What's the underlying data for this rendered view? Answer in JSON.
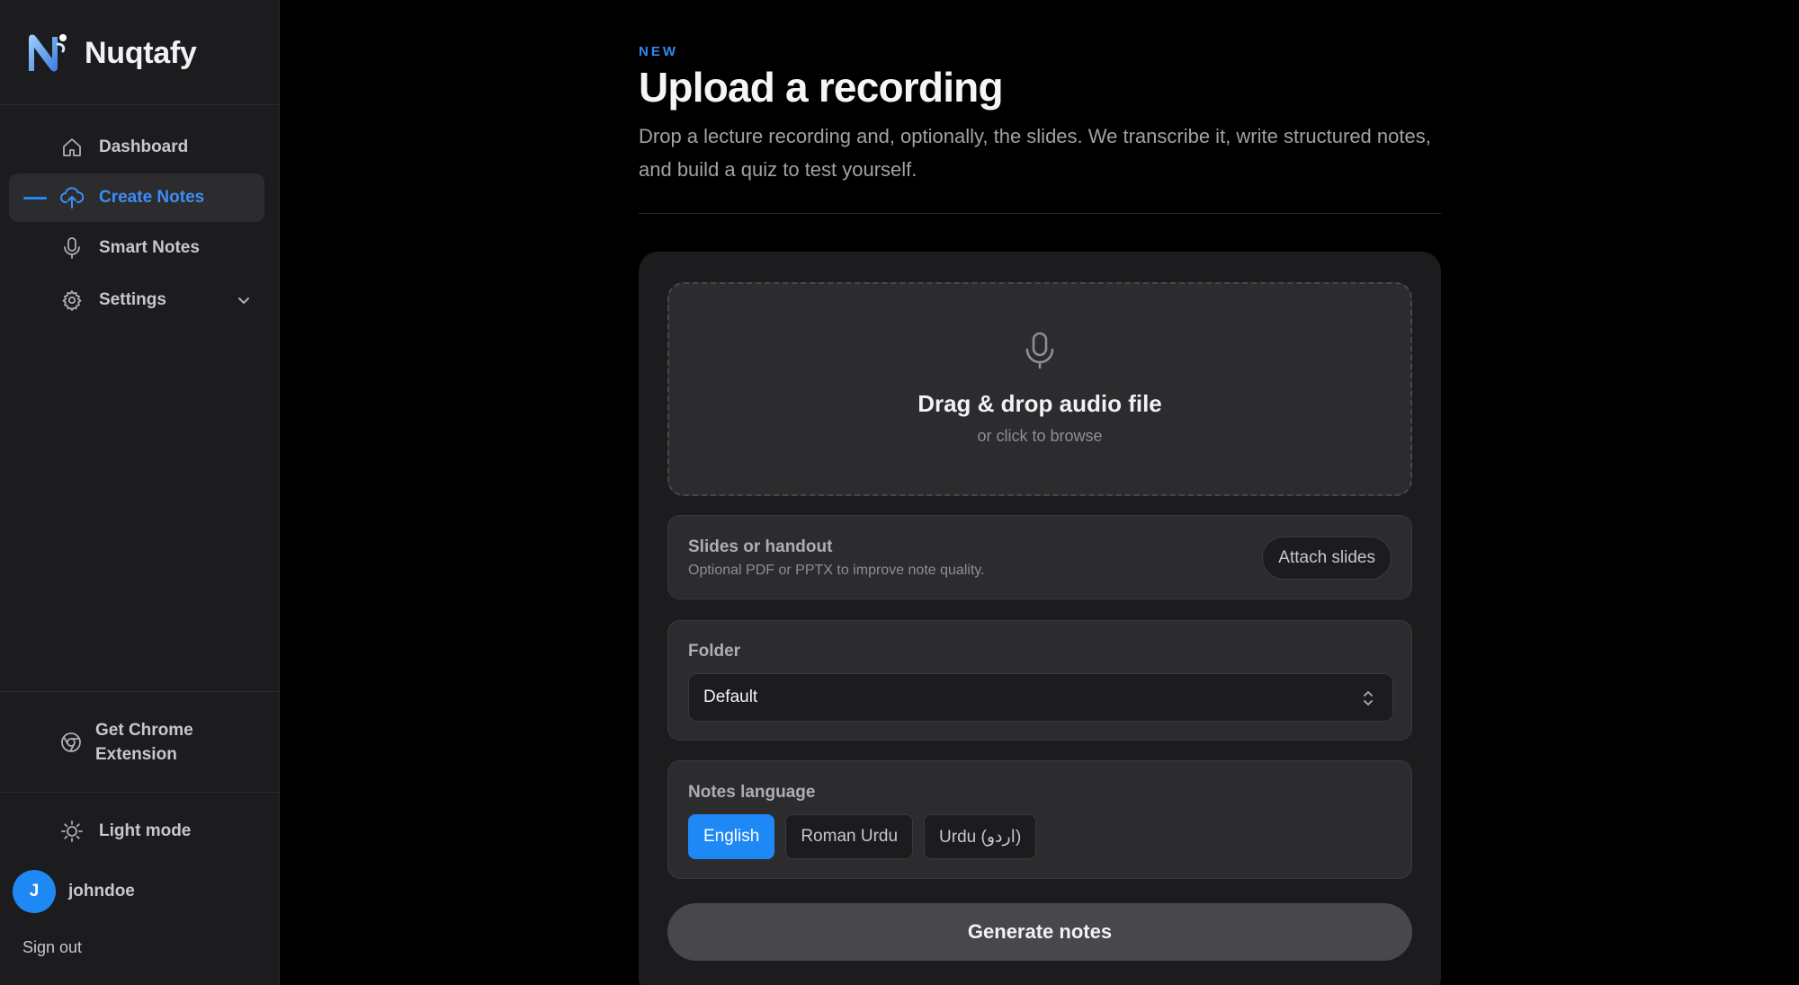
{
  "brand": {
    "name": "Nuqtafy"
  },
  "sidebar": {
    "items": [
      {
        "label": "Dashboard",
        "icon": "home-icon"
      },
      {
        "label": "Create Notes",
        "icon": "cloud-upload-icon",
        "active": true
      },
      {
        "label": "Smart Notes",
        "icon": "microphone-icon"
      },
      {
        "label": "Settings",
        "icon": "gear-icon"
      }
    ],
    "chrome_extension_label": "Get Chrome Extension",
    "light_mode_label": "Light mode",
    "user": {
      "initial": "J",
      "name": "johndoe"
    },
    "sign_out_label": "Sign out"
  },
  "main": {
    "eyebrow": "NEW",
    "title": "Upload a recording",
    "description": "Drop a lecture recording and, optionally, the slides. We transcribe it, write structured notes, and build a quiz to test yourself.",
    "dropzone": {
      "title": "Drag & drop audio file",
      "subtitle": "or click to browse"
    },
    "slides": {
      "title": "Slides or handout",
      "subtitle": "Optional PDF or PPTX to improve note quality.",
      "button_label": "Attach slides"
    },
    "folder": {
      "label": "Folder",
      "selected": "Default"
    },
    "language": {
      "label": "Notes language",
      "options": [
        "English",
        "Roman Urdu",
        "Urdu (اردو)"
      ],
      "selected": "English"
    },
    "generate_label": "Generate notes"
  },
  "colors": {
    "accent": "#1e88f5",
    "sidebar_bg": "#1c1c1e",
    "page_bg": "#000000"
  }
}
